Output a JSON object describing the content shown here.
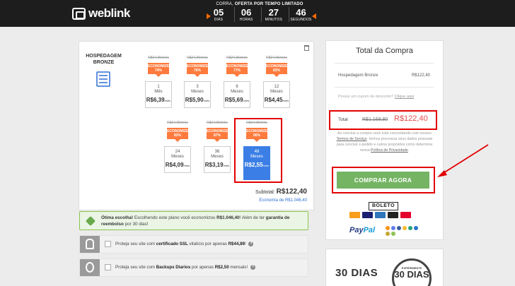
{
  "header": {
    "brand": "weblink",
    "timer": {
      "label_prefix": "CORRA,",
      "label_strong": "OFERTA POR TEMPO LIMITADO",
      "units": [
        {
          "value": "05",
          "caption": "DIAS"
        },
        {
          "value": "06",
          "caption": "HORAS"
        },
        {
          "value": "27",
          "caption": "MINUTOS"
        },
        {
          "value": "46",
          "caption": "SEGUNDOS"
        }
      ]
    }
  },
  "product": {
    "title": "HOSPEDAGEM BRONZE",
    "plans": [
      {
        "old": "R$24,95/mês",
        "badge_label": "ECONOMIZE",
        "badge_value": "74%",
        "months": "1",
        "unit": "Mês",
        "price": "R$6,39",
        "per": "/mês",
        "selected": false
      },
      {
        "old": "R$24,95/mês",
        "badge_label": "ECONOMIZE",
        "badge_value": "76%",
        "months": "3",
        "unit": "Meses",
        "price": "R$5,90",
        "per": "/mês",
        "selected": false
      },
      {
        "old": "R$24,95/mês",
        "badge_label": "ECONOMIZE",
        "badge_value": "77%",
        "months": "6",
        "unit": "Meses",
        "price": "R$5,69",
        "per": "/mês",
        "selected": false
      },
      {
        "old": "R$24,95/mês",
        "badge_label": "ECONOMIZE",
        "badge_value": "82%",
        "months": "12",
        "unit": "Meses",
        "price": "R$4,45",
        "per": "/mês",
        "selected": false
      },
      {
        "old": "R$24,95/mês",
        "badge_label": "ECONOMIZE",
        "badge_value": "83%",
        "months": "24",
        "unit": "Meses",
        "price": "R$4,09",
        "per": "/mês",
        "selected": false
      },
      {
        "old": "R$24,95/mês",
        "badge_label": "ECONOMIZE",
        "badge_value": "87%",
        "months": "36",
        "unit": "Meses",
        "price": "R$3,19",
        "per": "/mês",
        "selected": false
      },
      {
        "old": "R$24,95/mês",
        "badge_label": "ECONOMIZE",
        "badge_value": "90%",
        "months": "48",
        "unit": "Meses",
        "price": "R$2,55",
        "per": "/mês",
        "selected": true
      }
    ],
    "subtotal_label": "Subtotal:",
    "subtotal_value": "R$122,40",
    "economy": "Economia de R$1.046,40"
  },
  "notice": {
    "strong1": "Ótima escolha!",
    "text1": " Escolhendo este plano você economizou ",
    "strong2": "R$1.046,40",
    "text2": "! Além de ter ",
    "strong3": "garantia de reembolso",
    "text3": " por 30 dias!"
  },
  "addons": [
    {
      "pre": "Proteja seu site com ",
      "strong": "certificado SSL",
      "post": " vitalício por apenas ",
      "price": "R$44,89",
      "end": "!",
      "help": "?"
    },
    {
      "pre": "Proteja seu site com ",
      "strong": "Backups Diarios",
      "post": " por apenas ",
      "price": "R$2,50",
      "end": " mensais!",
      "help": "?"
    }
  ],
  "summary": {
    "title": "Total da Compra",
    "item_name": "Hospedagem Bronze",
    "item_price": "R$122,40",
    "coupon_text": "Possui um cupom de desconto?",
    "coupon_link": "Clique aqui",
    "total_label": "Total",
    "total_old": "R$1.168,80",
    "total_new": "R$122,40",
    "legal_1": "Ao concluir a compra você está concordando com nossos ",
    "legal_terms": "Termos de Serviço",
    "legal_2": ". Iremos processar seus dados pessoais para concluir o pedido e outros propósitos como determina nossa ",
    "legal_privacy": "Política de Privacidade",
    "legal_3": ".",
    "buy_label": "COMPRAR AGORA",
    "boleto": "BOLETO",
    "paypal_a": "Pay",
    "paypal_b": "Pal"
  },
  "guarantee": {
    "days": "30 DIAS",
    "seal_top": "EXPERIMENTE",
    "seal_num": "30 DIAS"
  },
  "colors": {
    "accent_orange": "#ff7a3d",
    "selected_blue": "#3b7ee6",
    "buy_green": "#74b463",
    "highlight_red": "#e20000",
    "total_red": "#e54b4b"
  }
}
